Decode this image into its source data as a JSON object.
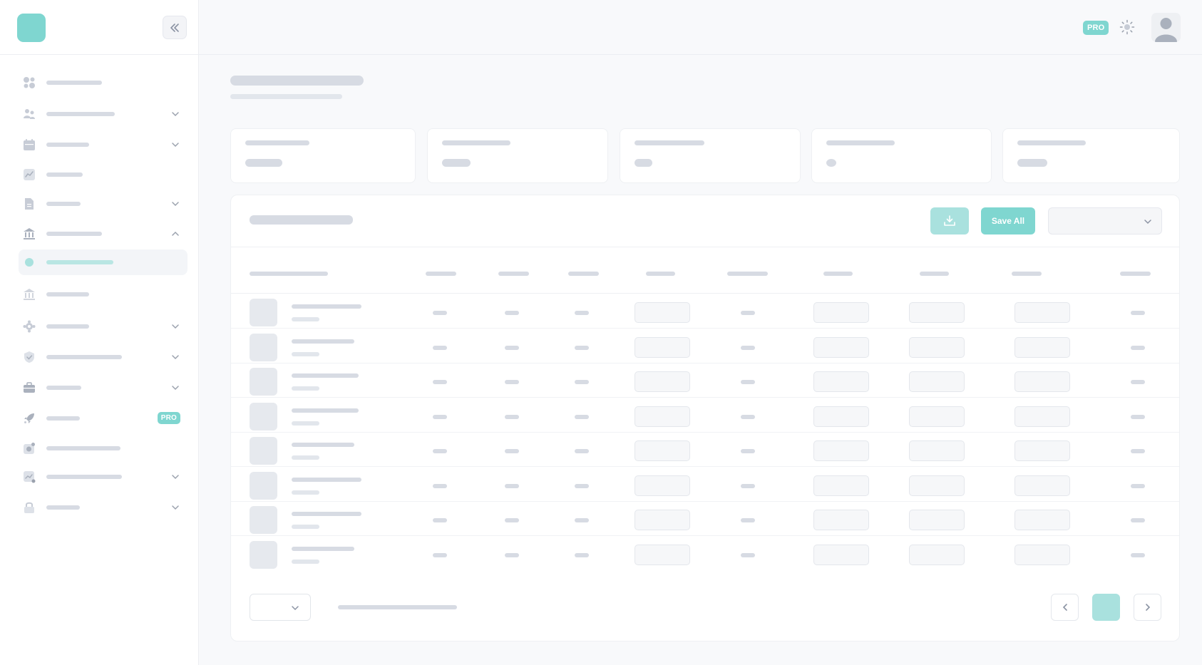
{
  "app": {
    "brand_color": "#7fd6d0",
    "sidebar_toggle_icon": "chevrons-left-icon",
    "theme_icon": "sun-icon",
    "avatar_icon": "user-avatar-icon"
  },
  "topbar": {
    "badge": "PRO"
  },
  "sidebar": {
    "items": [
      {
        "icon": "grid-icon",
        "has_chevron": false,
        "state": "none"
      },
      {
        "icon": "users-icon",
        "has_chevron": true,
        "state": "collapsed"
      },
      {
        "icon": "calendar-icon",
        "has_chevron": true,
        "state": "collapsed"
      },
      {
        "icon": "trend-icon",
        "has_chevron": false,
        "state": "none"
      },
      {
        "icon": "document-icon",
        "has_chevron": true,
        "state": "collapsed"
      },
      {
        "icon": "bank-icon",
        "has_chevron": true,
        "state": "expanded"
      },
      {
        "icon": "dot-icon",
        "has_chevron": false,
        "state": "active-subitem"
      },
      {
        "icon": "bank-icon",
        "has_chevron": false,
        "state": "subitem"
      },
      {
        "icon": "gear-icon",
        "has_chevron": true,
        "state": "collapsed"
      },
      {
        "icon": "shield-check-icon",
        "has_chevron": true,
        "state": "collapsed"
      },
      {
        "icon": "briefcase-icon",
        "has_chevron": true,
        "state": "collapsed"
      },
      {
        "icon": "rocket-icon",
        "has_chevron": false,
        "state": "none",
        "badge": "PRO"
      },
      {
        "icon": "camera-icon",
        "has_chevron": false,
        "state": "none"
      },
      {
        "icon": "chart-icon",
        "has_chevron": true,
        "state": "collapsed"
      },
      {
        "icon": "lock-icon",
        "has_chevron": true,
        "state": "collapsed"
      }
    ]
  },
  "toolbar": {
    "save_label": "Save All",
    "import_icon": "download-tray-icon",
    "select_icon": "chevron-down-icon"
  },
  "table": {
    "row_count": 8,
    "field_columns": 4
  },
  "pagination": {
    "current_page_highlighted": true,
    "prev_icon": "chevron-left-icon",
    "next_icon": "chevron-right-icon"
  }
}
